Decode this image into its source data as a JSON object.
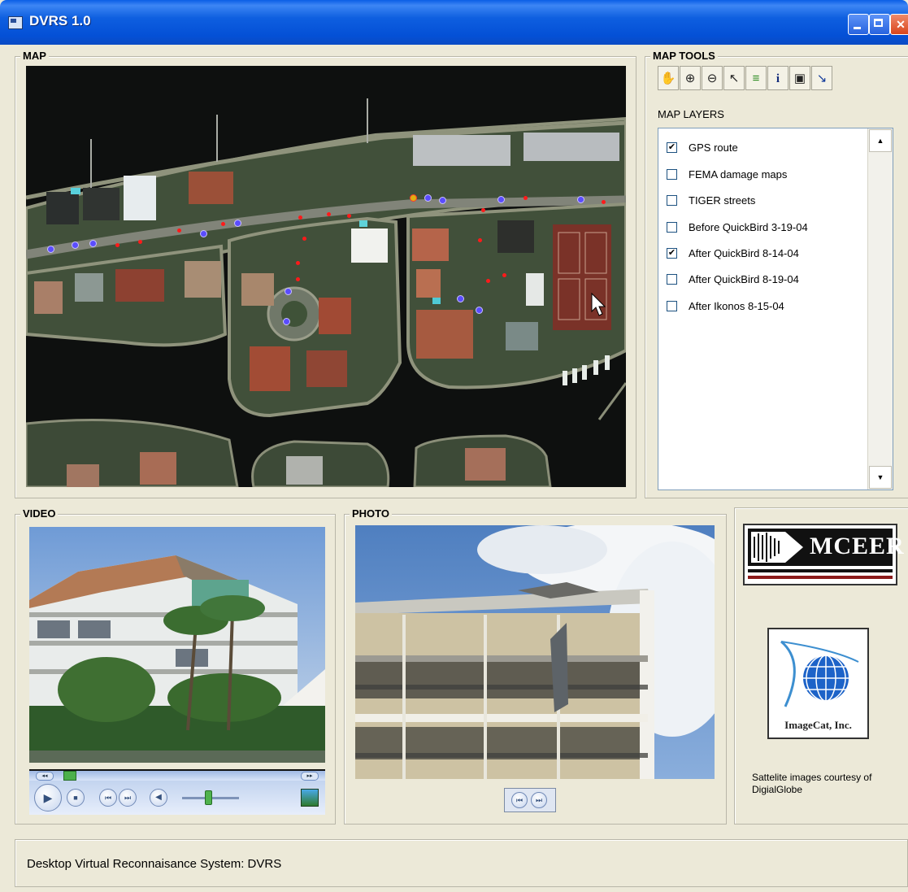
{
  "window": {
    "title": "DVRS 1.0",
    "controls": {
      "minimize": "minimize",
      "maximize": "maximize",
      "close": "close"
    }
  },
  "map_panel": {
    "label": "MAP"
  },
  "map_tools": {
    "label": "MAP TOOLS",
    "tools": [
      {
        "icon": "pan-hand-icon",
        "glyph": "✋"
      },
      {
        "icon": "zoom-in-icon",
        "glyph": "⊕"
      },
      {
        "icon": "zoom-out-icon",
        "glyph": "⊖"
      },
      {
        "icon": "select-pointer-icon",
        "glyph": "↖"
      },
      {
        "icon": "layers-icon",
        "glyph": "≡"
      },
      {
        "icon": "info-icon",
        "glyph": "i"
      },
      {
        "icon": "identify-box-icon",
        "glyph": "▣"
      },
      {
        "icon": "pin-pointer-icon",
        "glyph": "↘"
      }
    ]
  },
  "map_layers": {
    "label": "MAP LAYERS",
    "items": [
      {
        "label": "GPS route",
        "checked": true
      },
      {
        "label": "FEMA damage maps",
        "checked": false
      },
      {
        "label": "TIGER streets",
        "checked": false
      },
      {
        "label": "Before QuickBird 3-19-04",
        "checked": false
      },
      {
        "label": "After QuickBird 8-14-04",
        "checked": true
      },
      {
        "label": "After QuickBird 8-19-04",
        "checked": false
      },
      {
        "label": "After Ikonos 8-15-04",
        "checked": false
      }
    ]
  },
  "video_panel": {
    "label": "VIDEO"
  },
  "photo_panel": {
    "label": "PHOTO"
  },
  "credits": {
    "mceer_logo": "MCEER",
    "imagecat_logo": "ImageCat, Inc.",
    "imagery_credit": "Sattelite images courtesy of DigialGlobe"
  },
  "statusbar": {
    "text": "Desktop Virtual Reconnaisance System: DVRS"
  },
  "colors": {
    "titlebar": "#0450d6",
    "window_bg": "#ece9d8",
    "gps_red": "#ff1a1a",
    "gps_blue": "#5a4cff"
  }
}
